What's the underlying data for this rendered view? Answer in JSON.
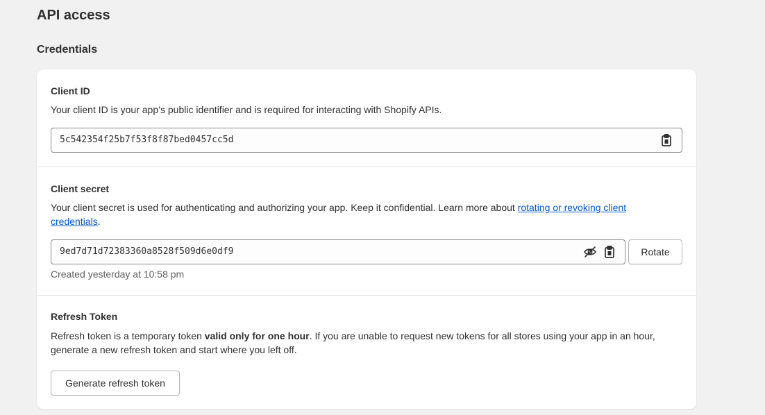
{
  "page": {
    "title": "API access",
    "section_title": "Credentials"
  },
  "client_id": {
    "label": "Client ID",
    "description": "Your client ID is your app’s public identifier and is required for interacting with Shopify APIs.",
    "value": "5c542354f25b7f53f8f87bed0457cc5d",
    "copy_icon": "clipboard-icon"
  },
  "client_secret": {
    "label": "Client secret",
    "description_prefix": "Your client secret is used for authenticating and authorizing your app. Keep it confidential. Learn more about ",
    "link_text": "rotating or revoking client credentials",
    "description_suffix": ".",
    "value": "9ed7d71d72383360a8528f509d6e0df9",
    "hide_icon": "eye-off-icon",
    "copy_icon": "clipboard-icon",
    "rotate_label": "Rotate",
    "created_text": "Created yesterday at 10:58 pm"
  },
  "refresh_token": {
    "label": "Refresh Token",
    "description_prefix": "Refresh token is a temporary token ",
    "description_bold": "valid only for one hour",
    "description_suffix": ". If you are unable to request new tokens for all stores using your app in an hour, generate a new refresh token and start where you left off.",
    "button_label": "Generate refresh token"
  },
  "colors": {
    "link": "#005bd3",
    "background": "#f1f1f1",
    "card": "#ffffff"
  }
}
